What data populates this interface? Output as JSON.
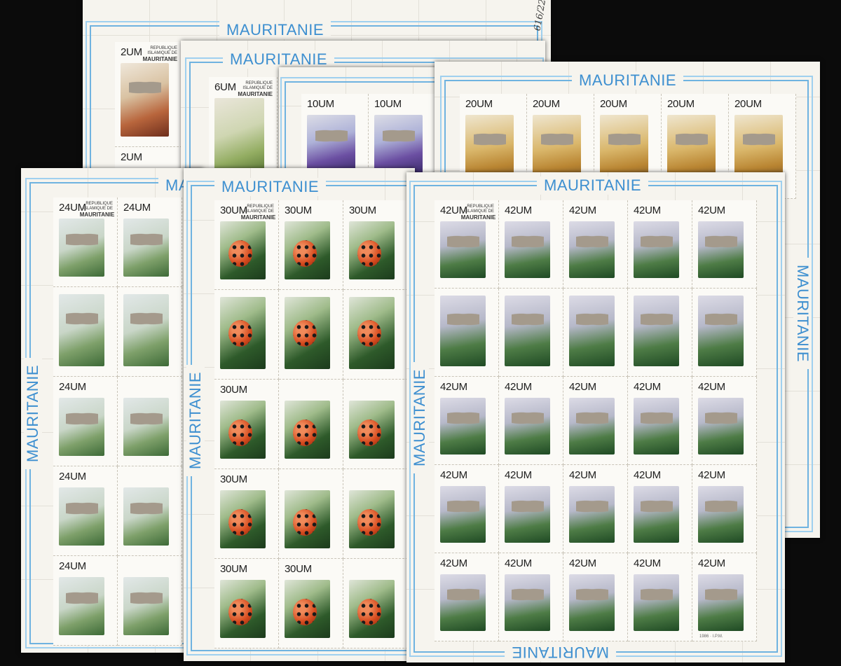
{
  "country": "MAURITANIE",
  "stamp_text": {
    "line1": "REPUBLIQUE ISLAMIQUE DE",
    "line2": "MAURITANIE",
    "footer": "1986 · I.P.M."
  },
  "handwritten_note": "616/22",
  "sheets": [
    {
      "id": "h",
      "value": "2UM"
    },
    {
      "id": "g",
      "value": "6UM"
    },
    {
      "id": "f",
      "value": "10UM"
    },
    {
      "id": "e",
      "value": "20UM"
    },
    {
      "id": "b",
      "value": "24UM"
    },
    {
      "id": "c",
      "value": "30UM"
    },
    {
      "id": "d",
      "value": "42UM"
    }
  ],
  "colors": {
    "border_blue": "#6fb3e0",
    "title_blue": "#3d8fd0",
    "paper": "#f6f4ee",
    "background": "#0b0b0b"
  }
}
